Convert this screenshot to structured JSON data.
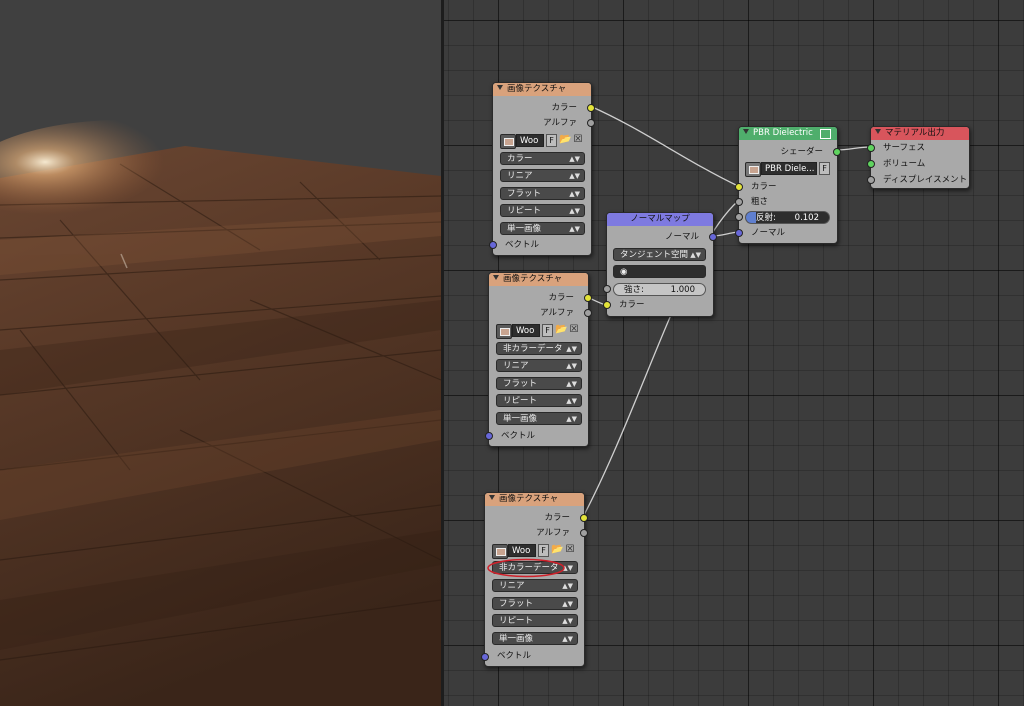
{
  "node_editor": {
    "nodes": {
      "image_texture_1": {
        "title": "画像テクスチャ",
        "outputs": {
          "color": "カラー",
          "alpha": "アルファ"
        },
        "image_name": "Woo",
        "fake_user": "F",
        "color_space": "カラー",
        "interpolation": "リニア",
        "projection": "フラット",
        "extension": "リピート",
        "source": "単一画像",
        "vector_input": "ベクトル"
      },
      "image_texture_2": {
        "title": "画像テクスチャ",
        "outputs": {
          "color": "カラー",
          "alpha": "アルファ"
        },
        "image_name": "Woo",
        "fake_user": "F",
        "color_space": "非カラーデータ",
        "interpolation": "リニア",
        "projection": "フラット",
        "extension": "リピート",
        "source": "単一画像",
        "vector_input": "ベクトル"
      },
      "image_texture_3": {
        "title": "画像テクスチャ",
        "outputs": {
          "color": "カラー",
          "alpha": "アルファ"
        },
        "image_name": "Woo",
        "fake_user": "F",
        "color_space": "非カラーデータ",
        "interpolation": "リニア",
        "projection": "フラット",
        "extension": "リピート",
        "source": "単一画像",
        "vector_input": "ベクトル"
      },
      "normal_map": {
        "title": "ノーマルマップ",
        "output": "ノーマル",
        "space": "タンジェント空間",
        "strength_label": "強さ:",
        "strength_value": "1.000",
        "color_input": "カラー"
      },
      "pbr_dielectric": {
        "title": "PBR Dielectric",
        "output": "シェーダー",
        "group_name": "PBR Diele...",
        "fake_user": "F",
        "inputs": {
          "color": "カラー",
          "roughness": "粗さ",
          "normal": "ノーマル"
        },
        "reflection_label": "反射:",
        "reflection_value": "0.102"
      },
      "material_output": {
        "title": "マテリアル出力",
        "inputs": {
          "surface": "サーフェス",
          "volume": "ボリューム",
          "displacement": "ディスプレイスメント"
        }
      }
    }
  },
  "colors": {
    "texture_header": "#d9a27c",
    "normal_header": "#7e7ae0",
    "shader_header": "#4fae6c",
    "output_header": "#d8555c",
    "annotation_circle": "#d0202a"
  }
}
